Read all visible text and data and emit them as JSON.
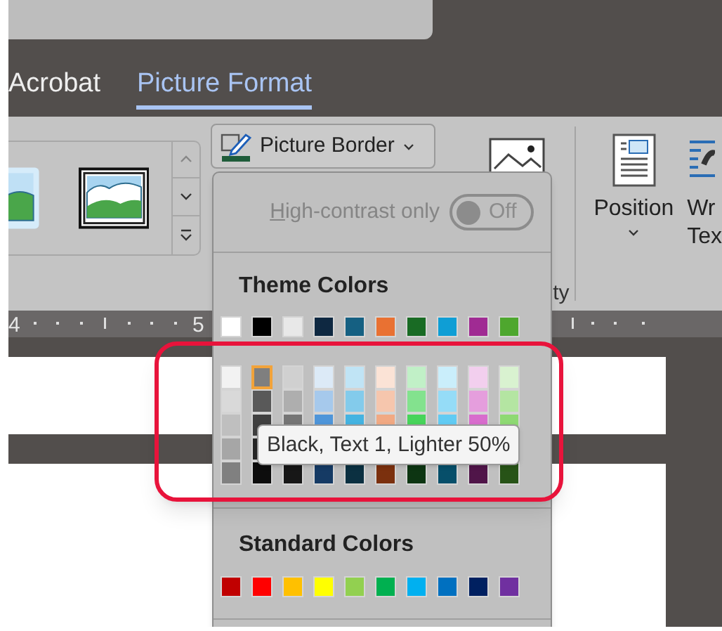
{
  "tabs": [
    {
      "label": "Acrobat",
      "selected": false
    },
    {
      "label": "Picture Format",
      "selected": true
    }
  ],
  "ribbon": {
    "picture_border_button": {
      "label": "Picture Border"
    },
    "group_label": "ty",
    "position_button": {
      "label": "Position"
    },
    "wrap_text_button": {
      "label_lines": [
        "Wr",
        "Tex"
      ]
    }
  },
  "ruler": {
    "labels": [
      "4",
      "5"
    ]
  },
  "color_menu": {
    "high_contrast": {
      "label": "High-contrast only",
      "on": false,
      "disabled": true,
      "state_text": "Off"
    },
    "theme_colors": {
      "title": "Theme Colors",
      "base": [
        {
          "color": "#ffffff"
        },
        {
          "color": "#000000"
        },
        {
          "color": "#e8e8e8"
        },
        {
          "color": "#0e2841"
        },
        {
          "color": "#156082"
        },
        {
          "color": "#e97132"
        },
        {
          "color": "#196b24"
        },
        {
          "color": "#0f9ed5"
        },
        {
          "color": "#a02b93"
        },
        {
          "color": "#4ea72e"
        }
      ],
      "shade_rows": [
        [
          {
            "color": "#f2f2f2",
            "selected": false
          },
          {
            "color": "#7f7f7f",
            "selected": true
          },
          {
            "color": "#d0d0d0",
            "selected": false
          },
          {
            "color": "#dceaf7",
            "selected": false
          },
          {
            "color": "#c0e4f5",
            "selected": false
          },
          {
            "color": "#fbe3d6",
            "selected": false
          },
          {
            "color": "#c1f0c7",
            "selected": false
          },
          {
            "color": "#caeefb",
            "selected": false
          },
          {
            "color": "#f2cfee",
            "selected": false
          },
          {
            "color": "#d9f2d0",
            "selected": false
          }
        ],
        [
          {
            "color": "#d9d9d9",
            "selected": false
          },
          {
            "color": "#595959",
            "selected": false
          },
          {
            "color": "#aeaeae",
            "selected": false
          },
          {
            "color": "#a6c9ec",
            "selected": false
          },
          {
            "color": "#83cbeb",
            "selected": false
          },
          {
            "color": "#f6c6ad",
            "selected": false
          },
          {
            "color": "#83e28e",
            "selected": false
          },
          {
            "color": "#95dcf7",
            "selected": false
          },
          {
            "color": "#e59edd",
            "selected": false
          },
          {
            "color": "#b4e5a2",
            "selected": false
          }
        ],
        [
          {
            "color": "#bfbfbf",
            "selected": false
          },
          {
            "color": "#404040",
            "selected": false
          },
          {
            "color": "#757575",
            "selected": false
          },
          {
            "color": "#4e95d9",
            "selected": false
          },
          {
            "color": "#44b3e1",
            "selected": false
          },
          {
            "color": "#f1a983",
            "selected": false
          },
          {
            "color": "#47d45a",
            "selected": false
          },
          {
            "color": "#61cbf3",
            "selected": false
          },
          {
            "color": "#d86dcd",
            "selected": false
          },
          {
            "color": "#8ed973",
            "selected": false
          }
        ],
        [
          {
            "color": "#a6a6a6",
            "selected": false
          },
          {
            "color": "#262626",
            "selected": false
          }
        ],
        [
          {
            "color": "#808080",
            "selected": false
          },
          {
            "color": "#0d0d0d",
            "selected": false
          },
          {
            "color": "#171717",
            "selected": false
          },
          {
            "color": "#153a64",
            "selected": false
          },
          {
            "color": "#0b3041",
            "selected": false
          },
          {
            "color": "#7b300e",
            "selected": false
          },
          {
            "color": "#0d3512",
            "selected": false
          },
          {
            "color": "#074f6a",
            "selected": false
          },
          {
            "color": "#501549",
            "selected": false
          },
          {
            "color": "#275317",
            "selected": false
          }
        ]
      ]
    },
    "standard_colors": {
      "title": "Standard Colors",
      "swatches": [
        {
          "color": "#c00000"
        },
        {
          "color": "#ff0000"
        },
        {
          "color": "#ffc000"
        },
        {
          "color": "#ffff00"
        },
        {
          "color": "#92d050"
        },
        {
          "color": "#00b050"
        },
        {
          "color": "#00b0f0"
        },
        {
          "color": "#0070c0"
        },
        {
          "color": "#002060"
        },
        {
          "color": "#7030a0"
        }
      ]
    }
  },
  "tooltip": {
    "text": "Black, Text 1, Lighter 50%"
  }
}
